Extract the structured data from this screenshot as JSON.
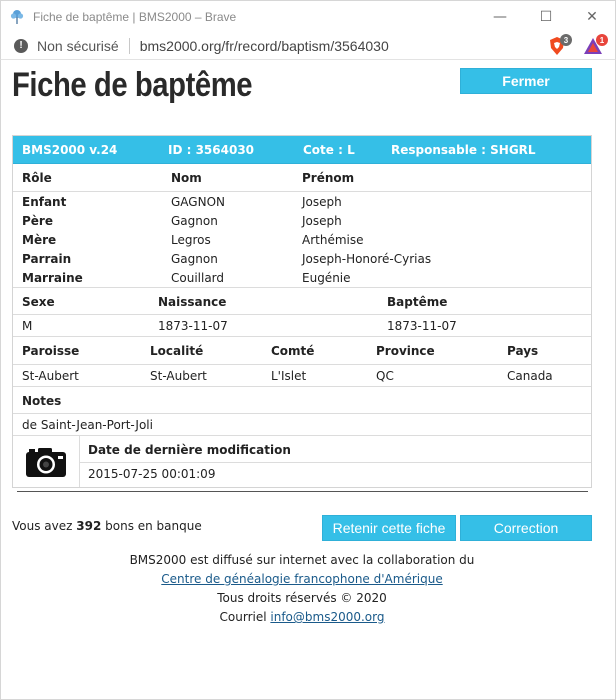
{
  "window": {
    "title": "Fiche de baptême | BMS2000 – Brave",
    "minimize": "—",
    "maximize": "☐",
    "close": "✕"
  },
  "address_bar": {
    "security": "Non sécurisé",
    "url": "bms2000.org/fr/record/baptism/3564030",
    "brave_badge": "3",
    "rewards_badge": "1"
  },
  "page": {
    "title": "Fiche de baptême",
    "close_button": "Fermer"
  },
  "record": {
    "header": {
      "version": "BMS2000 v.24",
      "id": "ID : 3564030",
      "cote": "Cote : L",
      "responsable": "Responsable : SHGRL"
    },
    "persons_headers": {
      "role": "Rôle",
      "nom": "Nom",
      "prenom": "Prénom"
    },
    "persons": [
      {
        "role": "Enfant",
        "nom": "GAGNON",
        "prenom": "Joseph"
      },
      {
        "role": "Père",
        "nom": "Gagnon",
        "prenom": "Joseph"
      },
      {
        "role": "Mère",
        "nom": "Legros",
        "prenom": "Arthémise"
      },
      {
        "role": "Parrain",
        "nom": "Gagnon",
        "prenom": "Joseph-Honoré-Cyrias"
      },
      {
        "role": "Marraine",
        "nom": "Couillard",
        "prenom": "Eugénie"
      }
    ],
    "events_headers": {
      "sexe": "Sexe",
      "naissance": "Naissance",
      "bapteme": "Baptême"
    },
    "events": {
      "sexe": "M",
      "naissance": "1873-11-07",
      "bapteme": "1873-11-07"
    },
    "place_headers": {
      "paroisse": "Paroisse",
      "localite": "Localité",
      "comte": "Comté",
      "province": "Province",
      "pays": "Pays"
    },
    "place": {
      "paroisse": "St-Aubert",
      "localite": "St-Aubert",
      "comte": "L'Islet",
      "province": "QC",
      "pays": "Canada"
    },
    "notes_header": "Notes",
    "notes": "de Saint-Jean-Port-Joli",
    "modification_header": "Date de dernière modification",
    "modification_date": "2015-07-25 00:01:09"
  },
  "bank": {
    "prefix": "Vous avez ",
    "count": "392",
    "suffix": " bons en banque"
  },
  "actions": {
    "retenir": "Retenir cette fiche",
    "correction": "Correction"
  },
  "footer": {
    "line1": "BMS2000 est diffusé sur internet avec la collaboration du",
    "link1": "Centre de généalogie francophone d'Amérique",
    "line3": "Tous droits réservés © 2020",
    "line4_prefix": "Courriel ",
    "email": "info@bms2000.org"
  }
}
